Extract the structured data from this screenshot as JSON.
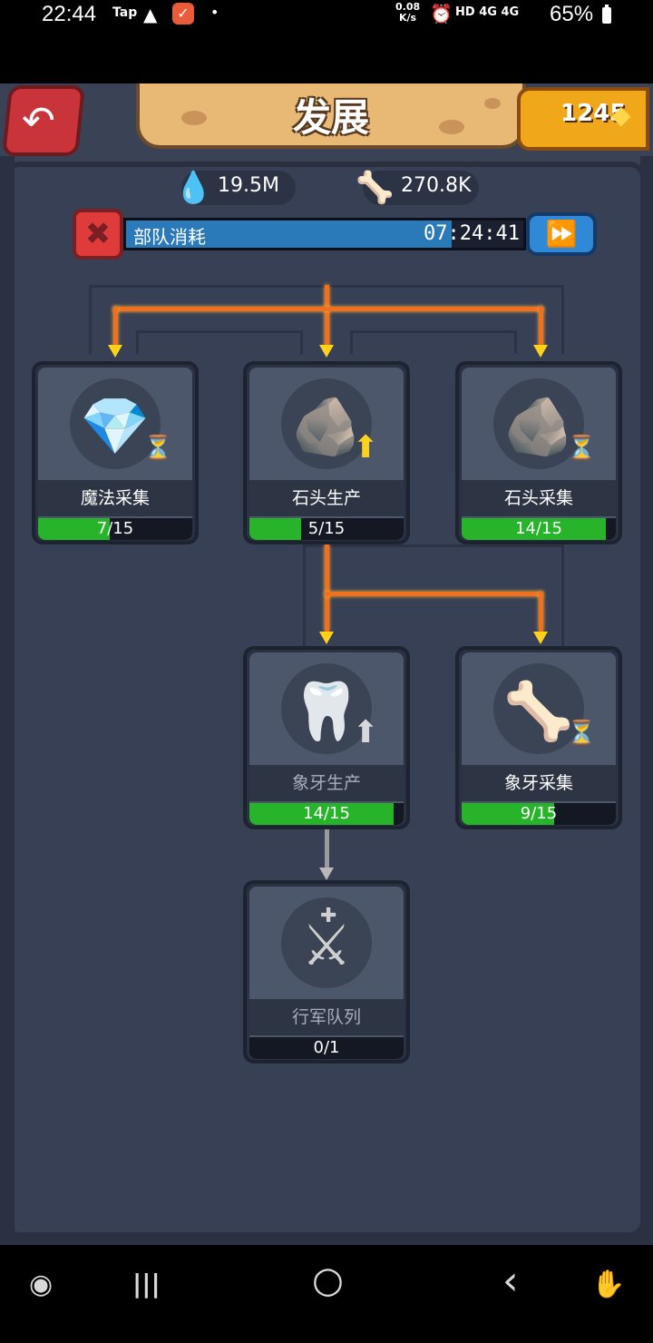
{
  "status_bar": {
    "time": "22:44",
    "app_label": "Tap",
    "warning_glyph": "▲",
    "check_glyph": "✓",
    "dot": "•",
    "net_speed": "0.08",
    "net_unit": "K/s",
    "alarm_glyph": "⏰",
    "signal_text": "HD 4G 4G",
    "battery": "65%"
  },
  "header": {
    "back_glyph": "↶",
    "title": "发展",
    "gems": "1245",
    "gem_glyph": "◆"
  },
  "resources": {
    "water": "19.5M",
    "water_glyph": "💧",
    "bone": "270.8K",
    "bone_glyph": "🦴"
  },
  "queue": {
    "cancel_glyph": "✖",
    "label": "部队消耗",
    "time": "07:24:41",
    "speedup_glyph": "⏩",
    "progress": 0.82
  },
  "nodes": [
    {
      "label": "魔法采集",
      "progress": "7/15",
      "fill": 0.467,
      "glyph": "💎",
      "badge": "⏳",
      "dim": false
    },
    {
      "label": "石头生产",
      "progress": "5/15",
      "fill": 0.333,
      "glyph": "🪨",
      "badge": "⬆",
      "dim": false
    },
    {
      "label": "石头采集",
      "progress": "14/15",
      "fill": 0.933,
      "glyph": "🪨",
      "badge": "⏳",
      "dim": false
    },
    {
      "label": "象牙生产",
      "progress": "14/15",
      "fill": 0.933,
      "glyph": "🦷",
      "badge": "⬆",
      "dim": true
    },
    {
      "label": "象牙采集",
      "progress": "9/15",
      "fill": 0.6,
      "glyph": "🦴",
      "badge": "⏳",
      "dim": false
    },
    {
      "label": "行军队列",
      "progress": "0/1",
      "fill": 0,
      "glyph": "⚔",
      "badge": "✚",
      "dim": true
    }
  ],
  "colors": {
    "lava": "#f07020",
    "arrow_active": "#ffd21a",
    "arrow_locked": "#b8b8b8",
    "progress_green": "#27b32a",
    "queue_blue": "#2a79b8"
  },
  "nav": {
    "game_icon": "◉",
    "recents_icon": "|||",
    "home_icon": "○",
    "back_icon": "‹",
    "touch_icon": "✋"
  }
}
